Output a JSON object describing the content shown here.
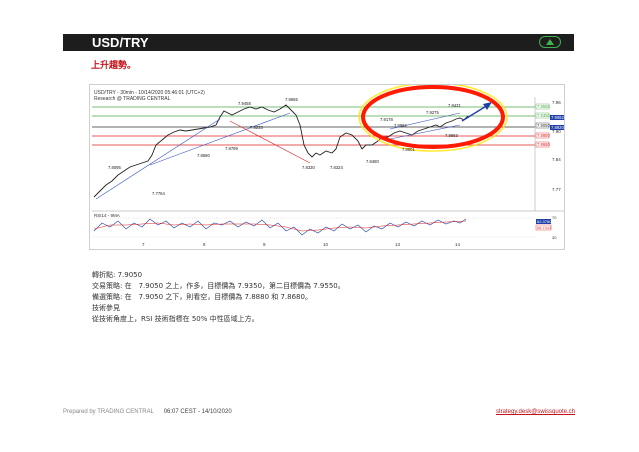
{
  "header": {
    "title": "USD/TRY"
  },
  "subtitle": "上升趨勢。",
  "chart": {
    "info_line1": "USD/TRY - 30min - 10/14/2020 05:46:01 (UTC+2)",
    "info_line2": "Research @ TRADING CENTRAL",
    "rsi_label": "RSI14 - 9MA",
    "price_labels": [
      "7.9655",
      "7.9458",
      "7.9431",
      "7.9275",
      "7.9178",
      "7.8962",
      "7.8901",
      "7.8863",
      "7.8799",
      "7.8580",
      "7.8330",
      "7.8324",
      "7.8480",
      "7.8095",
      "7.7764",
      "7.8233",
      "7.9275"
    ],
    "y_ticks": [
      "7.96",
      "7.93",
      "7.90",
      "7.87",
      "7.84",
      "7.77"
    ],
    "right_boxes": [
      "7.9050",
      "7.9062",
      "7.8920"
    ],
    "level_labels": [
      "7.9550",
      "7.9350",
      "7.8880",
      "7.8680"
    ],
    "rsi_ticks": [
      "70",
      "50",
      "30"
    ],
    "rsi_value": "62.3760",
    "rsi_value2": "58.7413",
    "x_ticks": [
      "7",
      "8",
      "9",
      "10",
      "13",
      "14"
    ]
  },
  "analysis": {
    "pivot": "轉折點: 7.9050",
    "strategy": "交易策略: 在　7.9050 之上，作多，目標價為 7.9350，第二目標價為 7.9550。",
    "alternative": "備選策略: 在　7.9050 之下，則看空，目標價為 7.8880 和 7.8680。",
    "comment_title": "技術參見",
    "comment": "從技術角度上，RSI 技術指標在 50% 中性區域上方。"
  },
  "footer": {
    "prepared": "Prepared by TRADING CENTRAL",
    "time": "06:07 CEST - 14/10/2020",
    "email": "strategy.desk@swissquote.ch"
  },
  "colors": {
    "accent_red": "#c4151c",
    "header_bg": "#1d1d1d",
    "up_green": "#3fb24c"
  }
}
